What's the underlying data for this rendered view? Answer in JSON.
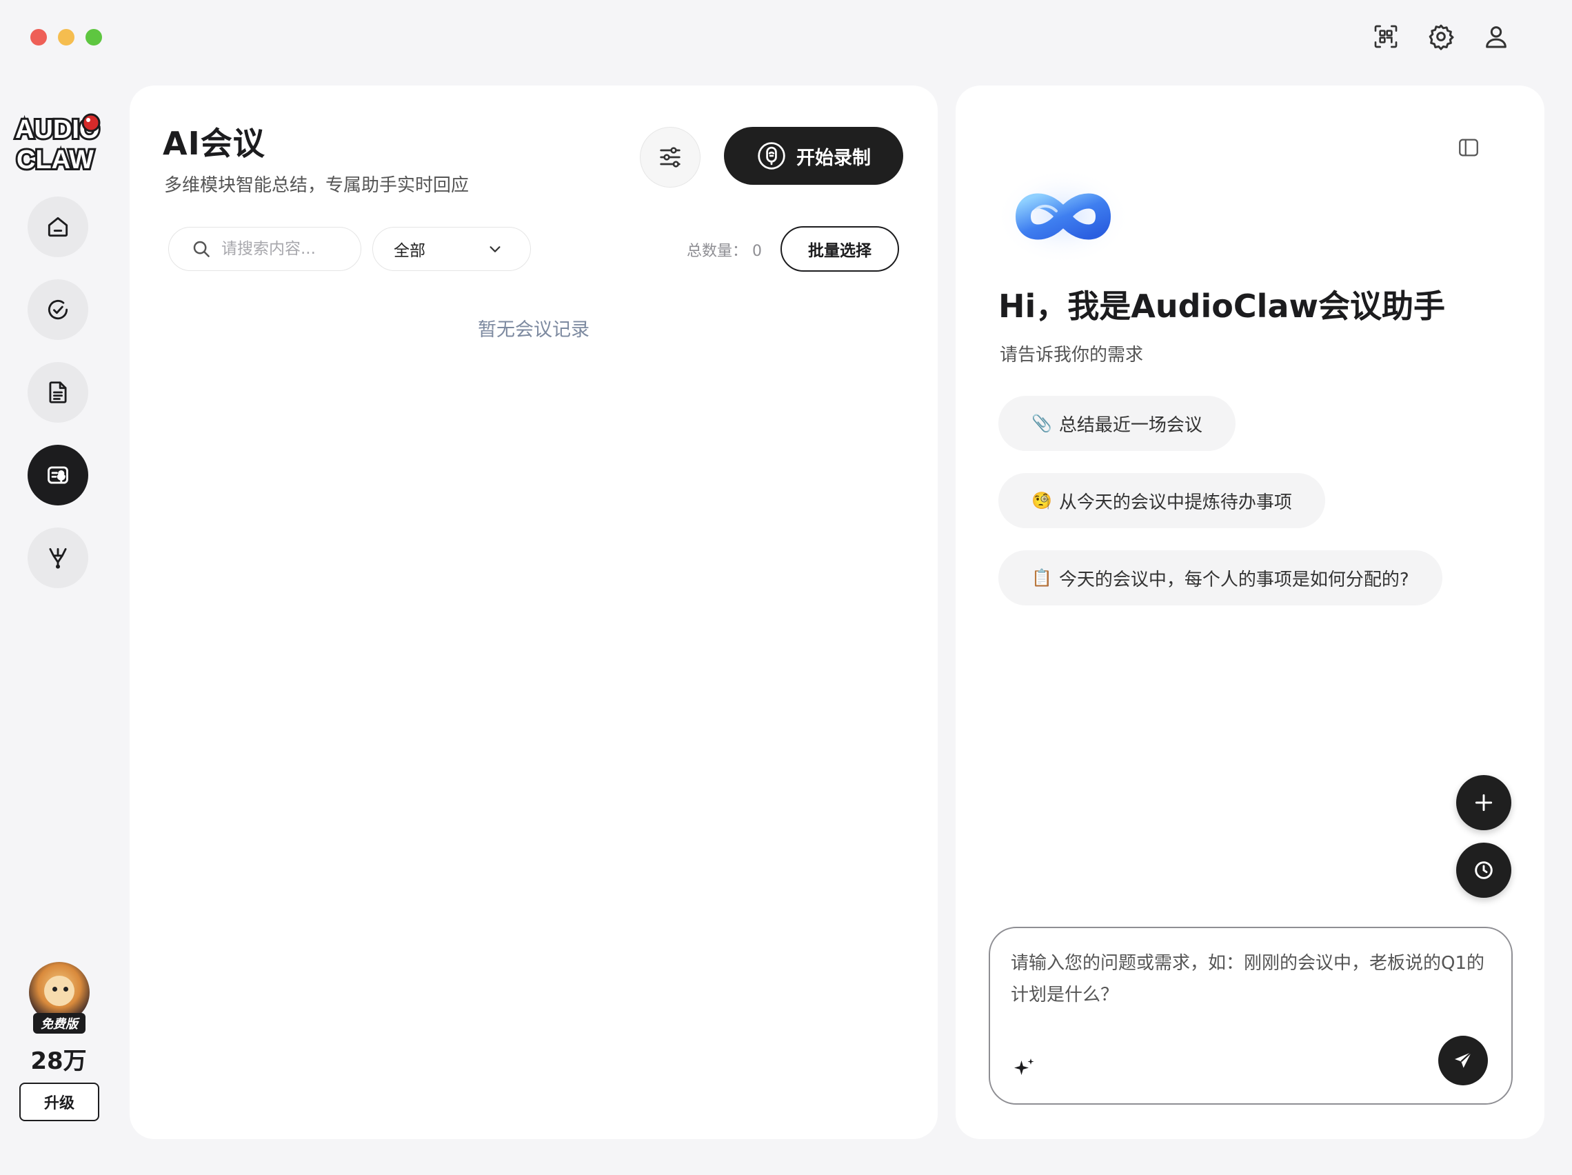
{
  "window": {
    "traffic_lights": [
      "close",
      "minimize",
      "maximize"
    ],
    "top_icons": [
      "qr-scan-icon",
      "gear-icon",
      "user-icon"
    ]
  },
  "sidebar": {
    "logo_text": [
      "AUDIO",
      "CLAW"
    ],
    "nav": [
      {
        "name": "home",
        "icon": "home-icon",
        "active": false
      },
      {
        "name": "tasks",
        "icon": "check-circle-icon",
        "active": false
      },
      {
        "name": "documents",
        "icon": "document-icon",
        "active": false
      },
      {
        "name": "ai-meeting",
        "icon": "meeting-mic-icon",
        "active": true
      },
      {
        "name": "workflow",
        "icon": "branch-icon",
        "active": false
      }
    ],
    "user": {
      "plan_badge": "免费版",
      "credits": "28万",
      "upgrade_label": "升级"
    }
  },
  "main": {
    "title": "AI会议",
    "subtitle": "多维模块智能总结，专属助手实时回应",
    "record_label": "开始录制",
    "search_placeholder": "请搜索内容...",
    "filter_value": "全部",
    "total_label": "总数量：",
    "total_value": "0",
    "batch_label": "批量选择",
    "empty_text": "暂无会议记录"
  },
  "assistant": {
    "title": "Hi，我是AudioClaw会议助手",
    "subtitle": "请告诉我你的需求",
    "suggestions": [
      {
        "emoji": "📎",
        "text": "总结最近一场会议"
      },
      {
        "emoji": "🧐",
        "text": "从今天的会议中提炼待办事项"
      },
      {
        "emoji": "📋",
        "text": "今天的会议中，每个人的事项是如何分配的?"
      }
    ],
    "input_placeholder": "请输入您的问题或需求，如：刚刚的会议中，老板说的Q1的计划是什么？"
  },
  "colors": {
    "background": "#f5f5f7",
    "panel": "#ffffff",
    "dark": "#1f1f1f",
    "accent_blue": "#4a8cf0",
    "muted_text": "#7d8aa0"
  }
}
